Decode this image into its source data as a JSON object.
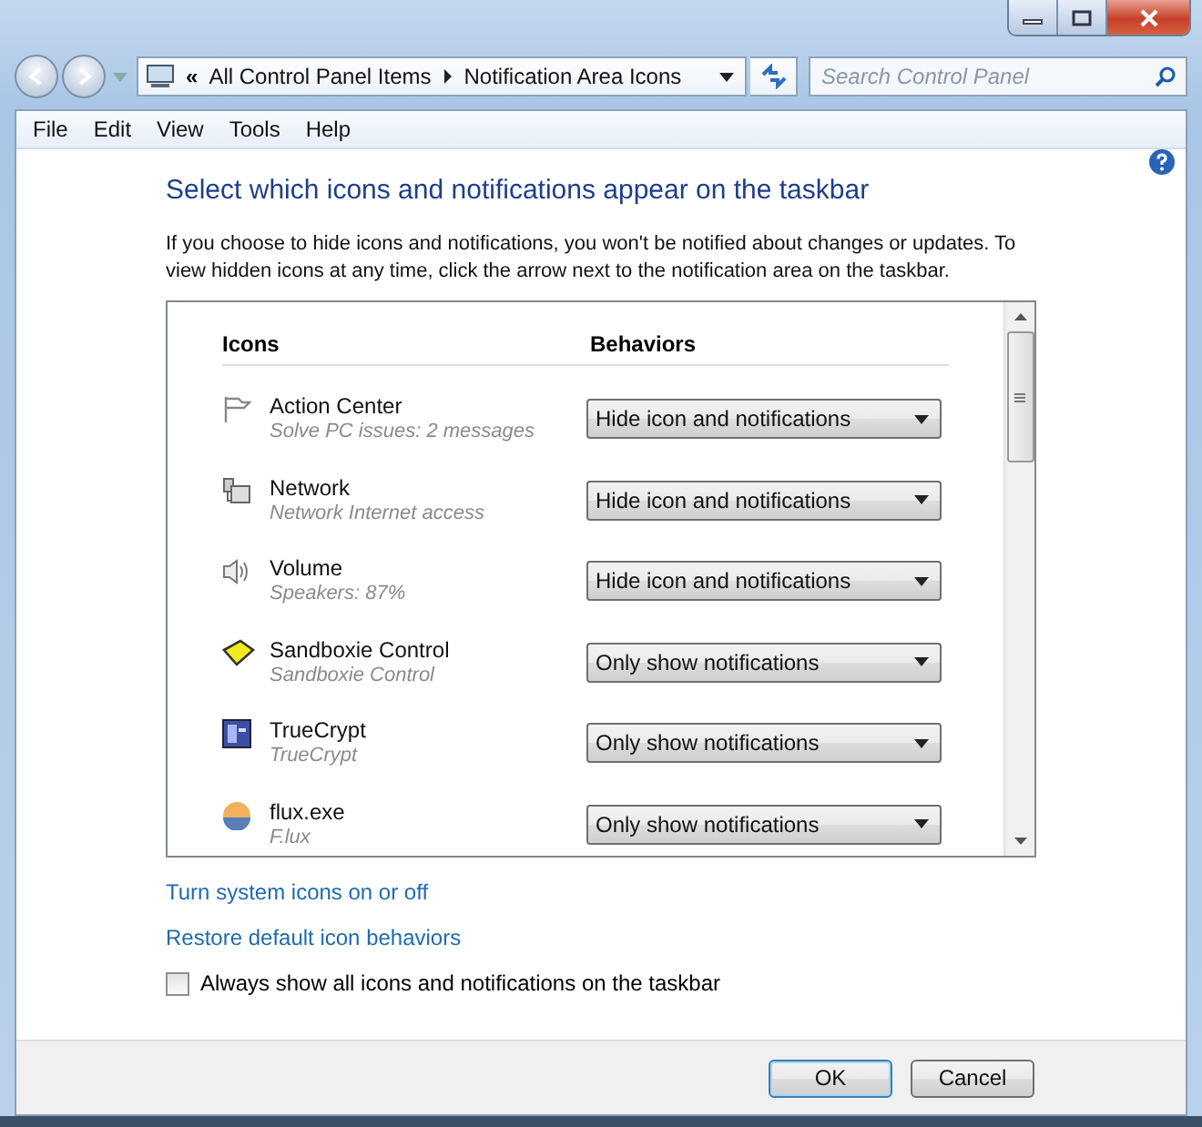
{
  "address_bar": {
    "separator": "«",
    "crumbs": [
      "All Control Panel Items",
      "Notification Area Icons"
    ]
  },
  "search": {
    "placeholder": "Search Control Panel"
  },
  "menu": [
    "File",
    "Edit",
    "View",
    "Tools",
    "Help"
  ],
  "heading": "Select which icons and notifications appear on the taskbar",
  "description": "If you choose to hide icons and notifications, you won't be notified about changes or updates. To view hidden icons at any time, click the arrow next to the notification area on the taskbar.",
  "table": {
    "columns": [
      "Icons",
      "Behaviors"
    ],
    "rows": [
      {
        "name": "Action Center",
        "detail": "Solve PC issues: 2 messages",
        "behavior": "Hide icon and notifications"
      },
      {
        "name": "Network",
        "detail": "Network Internet access",
        "behavior": "Hide icon and notifications"
      },
      {
        "name": "Volume",
        "detail": "Speakers: 87%",
        "behavior": "Hide icon and notifications"
      },
      {
        "name": "Sandboxie Control",
        "detail": "Sandboxie Control",
        "behavior": "Only show notifications"
      },
      {
        "name": "TrueCrypt",
        "detail": "TrueCrypt",
        "behavior": "Only show notifications"
      },
      {
        "name": "flux.exe",
        "detail": "F.lux",
        "behavior": "Only show notifications"
      }
    ]
  },
  "links": [
    "Turn system icons on or off",
    "Restore default icon behaviors"
  ],
  "checkbox": {
    "label": "Always show all icons and notifications on the taskbar",
    "checked": false
  },
  "buttons": [
    {
      "label": "OK",
      "default": true
    },
    {
      "label": "Cancel",
      "default": false
    }
  ]
}
